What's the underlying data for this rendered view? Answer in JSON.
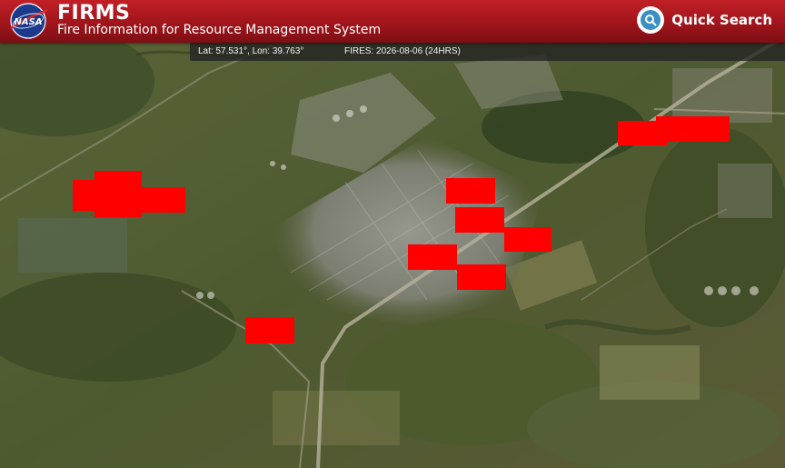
{
  "header": {
    "logo_text": "NASA",
    "title": "FIRMS",
    "subtitle": "Fire Information for Resource Management System",
    "quick_search_label": "Quick Search"
  },
  "status": {
    "latlon": "Lat: 57.531°, Lon: 39.763°",
    "fires": "FIRES: 2026-08-06 (24HRS)"
  },
  "colors": {
    "header_red": "#b81a21",
    "fire_pixel": "#ff0000",
    "search_icon_blue": "#3b8fc6"
  },
  "map": {
    "basemap": "satellite imagery",
    "fire_detection_count": 10
  }
}
